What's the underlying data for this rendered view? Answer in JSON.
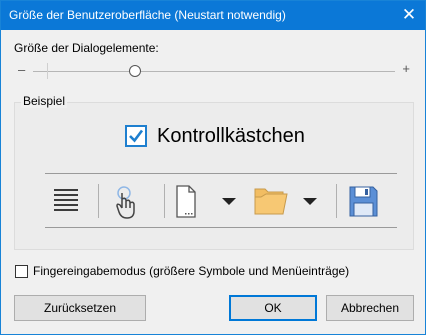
{
  "window": {
    "title": "Größe der Benutzeroberfläche (Neustart notwendig)",
    "close_glyph": "✕"
  },
  "size": {
    "label": "Größe der Dialogelemente:",
    "minus": "–",
    "plus": "+",
    "value_fraction": 0.27
  },
  "example": {
    "legend": "Beispiel",
    "checkbox_label": "Kontrollkästchen",
    "checkbox_checked": true,
    "toolbar_icons": [
      "menu-lines-icon",
      "touch-hand-icon",
      "new-document-icon",
      "dropdown-arrow-icon",
      "open-folder-icon",
      "dropdown-arrow-icon",
      "save-disk-icon"
    ]
  },
  "touch_mode": {
    "label": "Fingereingabemodus (größere Symbole und Menüeinträge)",
    "checked": false
  },
  "buttons": {
    "reset": "Zurücksetzen",
    "ok": "OK",
    "cancel": "Abbrechen"
  },
  "colors": {
    "titlebar": "#0b78d7",
    "accent": "#1e7fcf",
    "folder": "#f7c873",
    "disk": "#5b8fd6"
  }
}
